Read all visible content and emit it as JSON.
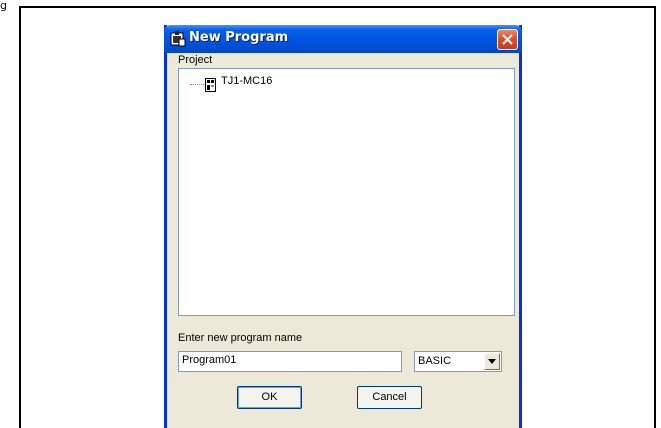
{
  "document": {
    "caption": "g"
  },
  "dialog": {
    "title": "New Program",
    "project_label": "Project",
    "tree": {
      "items": [
        {
          "label": "TJ1-MC16"
        }
      ]
    },
    "name_label": "Enter new program name",
    "name_value": "Program01",
    "language_selected": "BASIC",
    "ok_label": "OK",
    "cancel_label": "Cancel"
  },
  "colors": {
    "titlebar": "#0053e1",
    "window_border": "#0831d9",
    "dialog_bg": "#ece9d8",
    "close_button": "#d8532e"
  },
  "icons": {
    "app": "new-program-icon",
    "close": "close-icon",
    "tree_node": "controller-icon",
    "dropdown": "chevron-down-icon"
  }
}
